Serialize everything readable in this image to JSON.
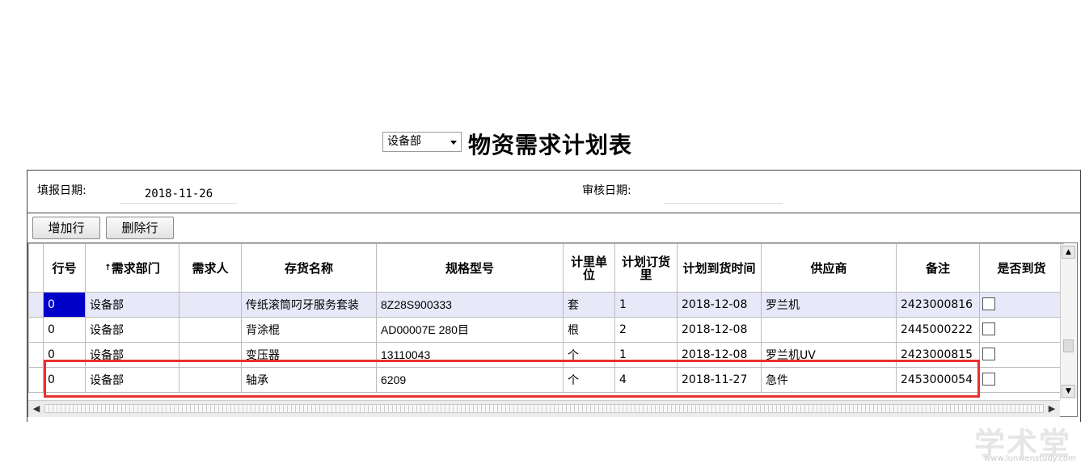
{
  "header": {
    "dept_select": "设备部",
    "title": "物资需求计划表"
  },
  "info": {
    "fill_date_label": "填报日期:",
    "fill_date_value": "2018-11-26",
    "review_date_label": "审核日期:",
    "review_date_value": ""
  },
  "toolbar": {
    "add_row": "增加行",
    "delete_row": "删除行"
  },
  "grid": {
    "columns": [
      "行号",
      "需求部门",
      "需求人",
      "存货名称",
      "规格型号",
      "计里单位",
      "计划订货里",
      "计划到货时间",
      "供应商",
      "备注",
      "是否到货"
    ],
    "rows": [
      {
        "line": "0",
        "dept": "设备部",
        "requester": "",
        "item": "传纸滚筒叼牙服务套装",
        "spec": "8Z28S900333",
        "unit": "套",
        "qty": "1",
        "date": "2018-12-08",
        "supplier": "罗兰机",
        "note": "2423000816",
        "arrived": false
      },
      {
        "line": "0",
        "dept": "设备部",
        "requester": "",
        "item": "背涂棍",
        "spec": "AD00007E 280目",
        "unit": "根",
        "qty": "2",
        "date": "2018-12-08",
        "supplier": "",
        "note": "2445000222",
        "arrived": false
      },
      {
        "line": "0",
        "dept": "设备部",
        "requester": "",
        "item": "变压器",
        "spec": "13110043",
        "unit": "个",
        "qty": "1",
        "date": "2018-12-08",
        "supplier": "罗兰机UV",
        "note": "2423000815",
        "arrived": false
      },
      {
        "line": "0",
        "dept": "设备部",
        "requester": "",
        "item": "轴承",
        "spec": "6209",
        "unit": "个",
        "qty": "4",
        "date": "2018-11-27",
        "supplier": "急件",
        "note": "2453000054",
        "arrived": false
      }
    ]
  },
  "watermark": {
    "text": "学术堂",
    "url": "www.lunwenstudy.com"
  },
  "colors": {
    "highlight": "#e8312f",
    "selected_row": "#e7e9f9",
    "active_cell": "#0000c8"
  }
}
